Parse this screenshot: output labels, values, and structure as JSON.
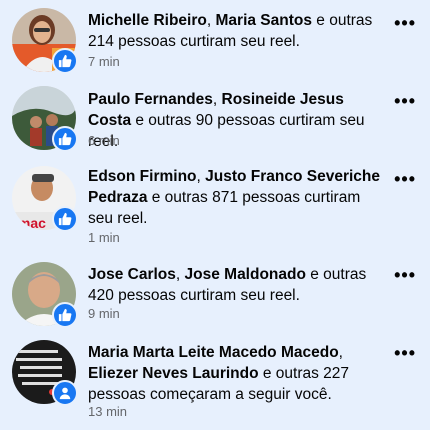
{
  "notifications": [
    {
      "name1": "Michelle Ribeiro",
      "sep": ", ",
      "name2": "Maria Santos",
      "rest": " e outras 214 pessoas curtiram seu reel.",
      "time": "7 min",
      "badge": "like-icon",
      "badge_color": "#1877f2"
    },
    {
      "name1": "Paulo Fernandes",
      "sep": ", ",
      "name2": "Rosineide Jesus Costa",
      "rest": " e outras 90 pessoas curtiram seu reel.",
      "time": "6 min",
      "badge": "like-icon",
      "badge_color": "#1877f2"
    },
    {
      "name1": "Edson Firmino",
      "sep": ", ",
      "name2": "Justo Franco Severiche Pedraza",
      "rest": " e outras 871 pessoas curtiram seu reel.",
      "time": "1 min",
      "badge": "like-icon",
      "badge_color": "#1877f2"
    },
    {
      "name1": "Jose Carlos",
      "sep": ", ",
      "name2": "Jose Maldonado",
      "rest": " e outras 420 pessoas curtiram seu reel.",
      "time": "9 min",
      "badge": "like-icon",
      "badge_color": "#1877f2"
    },
    {
      "name1": "Maria Marta Leite Macedo Macedo",
      "sep": ", ",
      "name2": "Eliezer Neves Laurindo",
      "rest": " e outras 227 pessoas começaram a seguir você.",
      "time": "13 min",
      "badge": "follow-person-icon",
      "badge_color": "#1877f2"
    }
  ],
  "more_label": "•••"
}
